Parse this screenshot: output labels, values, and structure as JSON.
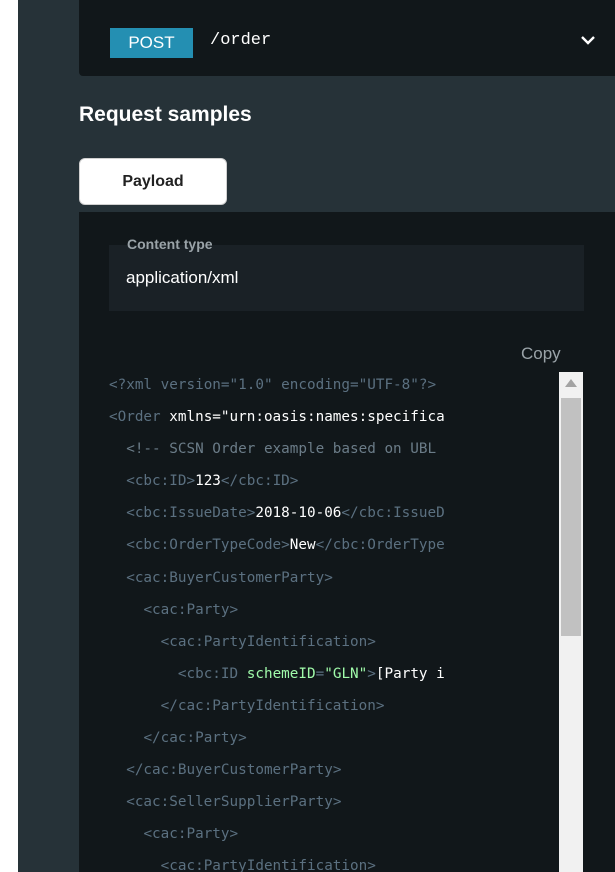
{
  "endpoint": {
    "method": "POST",
    "path": "/order",
    "chevron_icon": "chevron-down-icon"
  },
  "section_title": "Request samples",
  "tabs": [
    {
      "label": "Payload"
    }
  ],
  "content_type": {
    "label": "Content type",
    "value": "application/xml"
  },
  "copy_label": "Copy",
  "code_lines": [
    "<?xml version=\"1.0\" encoding=\"UTF-8\"?>",
    "<Order xmlns=\"urn:oasis:names:specifica",
    "  <!-- SCSN Order example based on UBL",
    "  <cbc:ID>123</cbc:ID>",
    "  <cbc:IssueDate>2018-10-06</cbc:IssueD",
    "  <cbc:OrderTypeCode>New</cbc:OrderType",
    "  <cac:BuyerCustomerParty>",
    "    <cac:Party>",
    "      <cac:PartyIdentification>",
    "        <cbc:ID schemeID=\"GLN\">[Party i",
    "      </cac:PartyIdentification>",
    "    </cac:Party>",
    "  </cac:BuyerCustomerParty>",
    "  <cac:SellerSupplierParty>",
    "    <cac:Party>",
    "      <cac:PartyIdentification>"
  ],
  "colors": {
    "method_badge": "#248fb2",
    "panel": "#263238",
    "code_bg": "#11171a",
    "attr": "#a0fbaa"
  }
}
